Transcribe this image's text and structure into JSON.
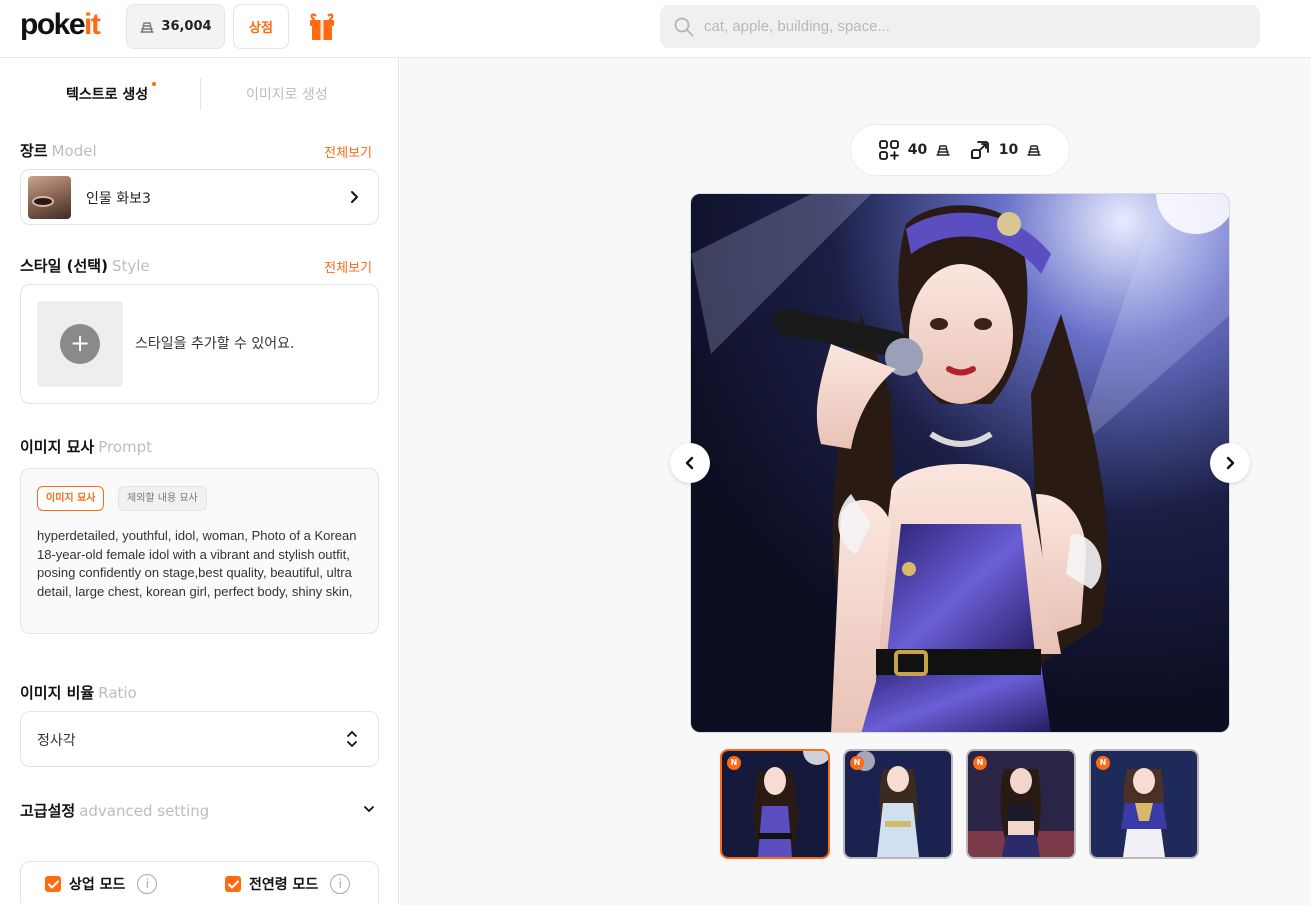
{
  "header": {
    "logo_main": "poke",
    "logo_accent": "it",
    "coin_balance": "36,004",
    "shop_label": "상점",
    "search_placeholder": "cat, apple, building, space..."
  },
  "sidebar": {
    "tabs": [
      {
        "label": "텍스트로 생성",
        "active": true
      },
      {
        "label": "이미지로 생성",
        "active": false
      }
    ],
    "model": {
      "title": "장르",
      "title_en": "Model",
      "see_all": "전체보기",
      "selected_name": "인물 화보3"
    },
    "style": {
      "title": "스타일 (선택)",
      "title_en": "Style",
      "see_all": "전체보기",
      "hint": "스타일을 추가할 수 있어요."
    },
    "prompt": {
      "title": "이미지 묘사",
      "title_en": "Prompt",
      "chip_active": "이미지 묘사",
      "chip_inactive": "제외할 내용 묘사",
      "text": "hyperdetailed, youthful, idol, woman, Photo of a Korean 18-year-old female idol with a vibrant and stylish outfit, posing confidently on stage,best quality, beautiful, ultra detail, large chest, korean girl, perfect body, shiny skin,"
    },
    "ratio": {
      "title": "이미지 비율",
      "title_en": "Ratio",
      "value": "정사각"
    },
    "advanced": {
      "title": "고급설정",
      "title_en": "advanced setting"
    },
    "modes": [
      {
        "label": "상업 모드",
        "checked": true
      },
      {
        "label": "전연령 모드",
        "checked": true
      }
    ]
  },
  "main": {
    "counters": [
      {
        "icon": "grid-add-icon",
        "value": "40"
      },
      {
        "icon": "upscale-icon",
        "value": "10"
      }
    ],
    "thumbnails": [
      {
        "badge": "N",
        "selected": true
      },
      {
        "badge": "N",
        "selected": false
      },
      {
        "badge": "N",
        "selected": false
      },
      {
        "badge": "N",
        "selected": false
      }
    ]
  },
  "colors": {
    "accent": "#ff6a13",
    "dress": "#4a3fa8"
  }
}
